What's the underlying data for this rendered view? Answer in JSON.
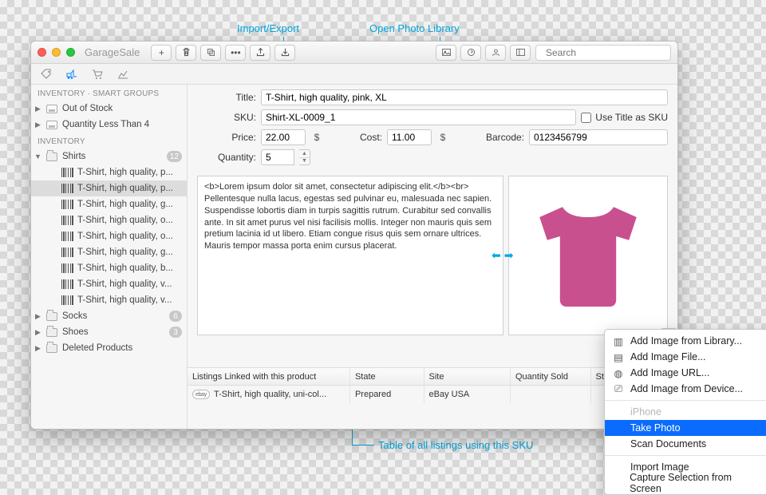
{
  "callouts": {
    "import_export": "Import/Export",
    "open_photo_library": "Open Photo Library",
    "table_caption": "Table of all listings using this SKU"
  },
  "app_title": "GarageSale",
  "search_placeholder": "Search",
  "sidebar": {
    "groups": {
      "smart": "INVENTORY · SMART GROUPS",
      "inventory": "INVENTORY"
    },
    "smart_items": [
      {
        "label": "Out of Stock"
      },
      {
        "label": "Quantity Less Than 4"
      }
    ],
    "folders": {
      "shirts": {
        "label": "Shirts",
        "badge": "12"
      },
      "socks": {
        "label": "Socks",
        "badge": "6"
      },
      "shoes": {
        "label": "Shoes",
        "badge": "3"
      },
      "deleted": {
        "label": "Deleted Products"
      }
    },
    "shirts_items": [
      "T-Shirt, high quality, p...",
      "T-Shirt, high quality, p...",
      "T-Shirt, high quality, g...",
      "T-Shirt, high quality, o...",
      "T-Shirt, high quality, o...",
      "T-Shirt, high quality, g...",
      "T-Shirt, high quality, b...",
      "T-Shirt, high quality, v...",
      "T-Shirt, high quality, v..."
    ],
    "selected_index": 1
  },
  "form": {
    "labels": {
      "title": "Title:",
      "sku": "SKU:",
      "price": "Price:",
      "cost": "Cost:",
      "barcode": "Barcode:",
      "quantity": "Quantity:",
      "use_title_as_sku": "Use Title as SKU"
    },
    "values": {
      "title": "T-Shirt, high quality, pink, XL",
      "sku": "Shirt-XL-0009_1",
      "price": "22.00",
      "cost": "11.00",
      "currency": "$",
      "barcode": "0123456799",
      "quantity": "5"
    }
  },
  "description": "<b>Lorem ipsum dolor sit amet, consectetur adipiscing elit.</b><br>\nPellentesque nulla lacus, egestas sed pulvinar eu, malesuada nec sapien. Suspendisse lobortis diam in turpis sagittis rutrum. Curabitur sed convallis ante. In sit amet purus vel nisi facilisis mollis. Integer non mauris quis sem pretium lacinia id ut libero. Etiam congue risus quis sem ornare ultrices. Mauris tempor massa porta enim cursus placerat.",
  "image": {
    "color": "#c9508f"
  },
  "linked_table": {
    "title": "Listings Linked with this product",
    "columns": {
      "state": "State",
      "site": "Site",
      "qty": "Quantity Sold",
      "start": "Start Date"
    },
    "rows": [
      {
        "name": "T-Shirt, high quality, uni-col...",
        "state": "Prepared",
        "site": "eBay USA",
        "qty": "",
        "start": ""
      }
    ]
  },
  "context_menu": {
    "items": [
      {
        "label": "Add Image from Library...",
        "icon": "library"
      },
      {
        "label": "Add Image File...",
        "icon": "file"
      },
      {
        "label": "Add Image URL...",
        "icon": "globe"
      },
      {
        "label": "Add Image from Device...",
        "icon": "device"
      }
    ],
    "section": [
      {
        "label": "iPhone",
        "disabled": true
      },
      {
        "label": "Take Photo",
        "selected": true
      },
      {
        "label": "Scan Documents"
      }
    ],
    "footer": [
      {
        "label": "Import Image"
      },
      {
        "label": "Capture Selection from Screen"
      }
    ]
  }
}
